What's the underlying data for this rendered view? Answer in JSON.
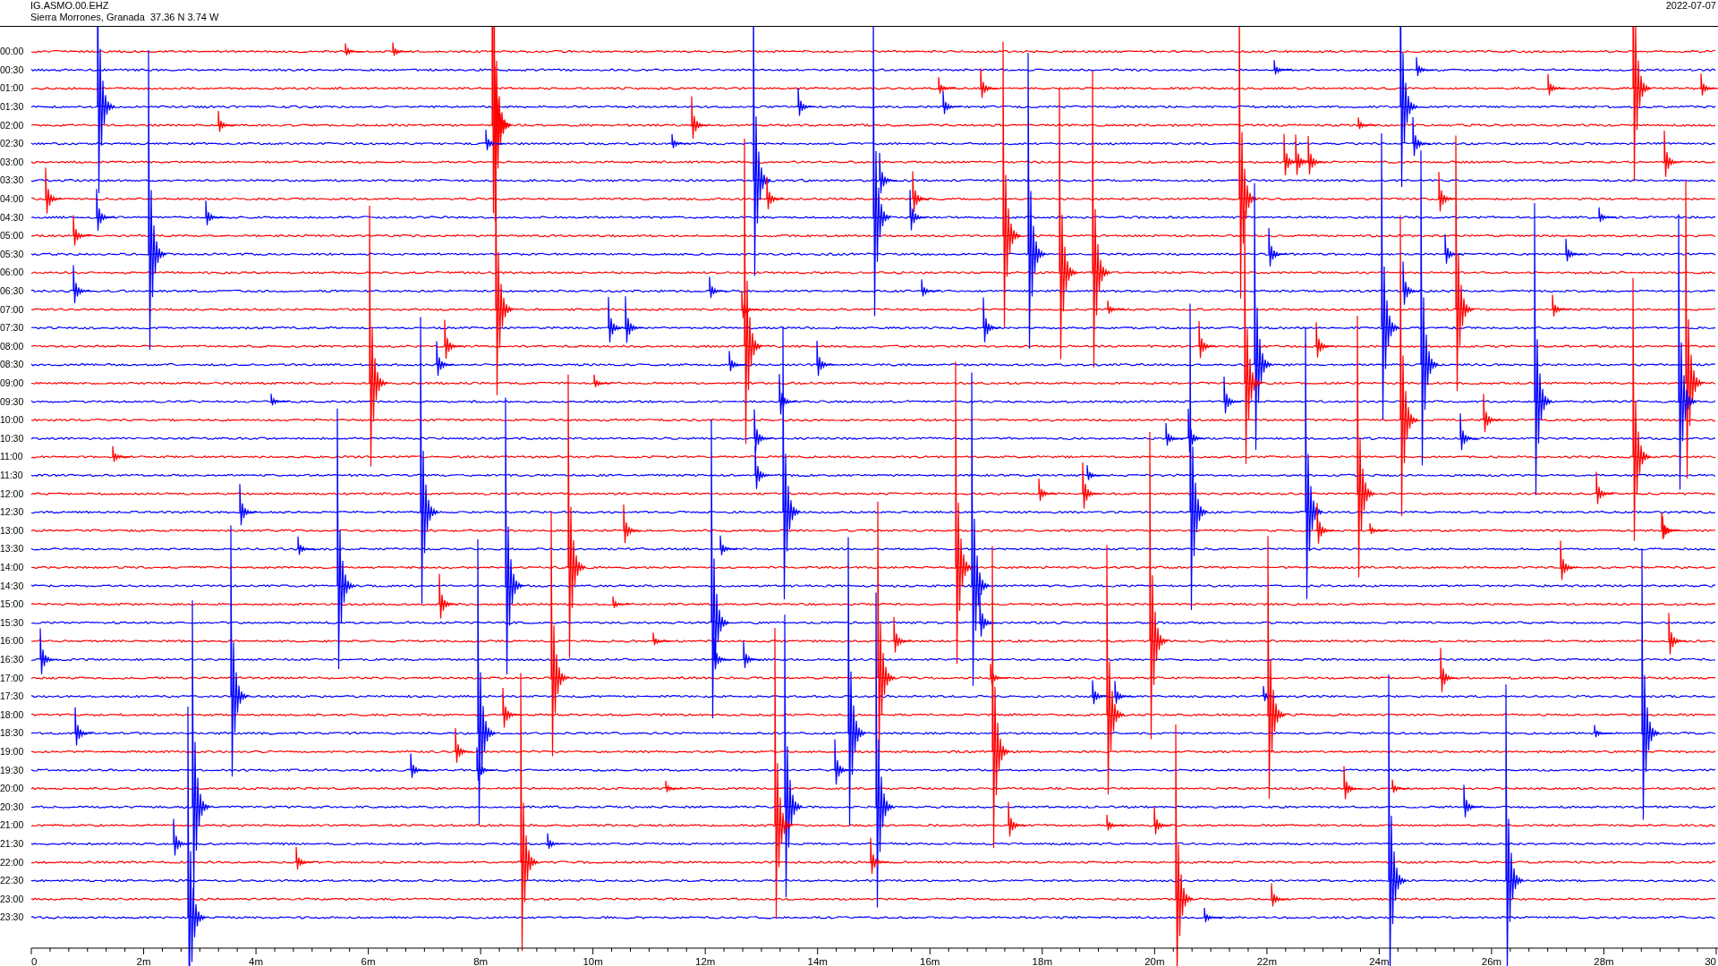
{
  "header": {
    "station": "IG.ASMO.00.EHZ",
    "location": "Sierra Morrones, Granada  37.36 N 3.74 W",
    "date": "2022-07-07"
  },
  "rows": [
    {
      "label": "00:00",
      "color": "#ff0000"
    },
    {
      "label": "00:30",
      "color": "#0000ff"
    },
    {
      "label": "01:00",
      "color": "#ff0000"
    },
    {
      "label": "01:30",
      "color": "#0000ff"
    },
    {
      "label": "02:00",
      "color": "#ff0000"
    },
    {
      "label": "02:30",
      "color": "#0000ff"
    },
    {
      "label": "03:00",
      "color": "#ff0000"
    },
    {
      "label": "03:30",
      "color": "#0000ff"
    },
    {
      "label": "04:00",
      "color": "#ff0000"
    },
    {
      "label": "04:30",
      "color": "#0000ff"
    },
    {
      "label": "05:00",
      "color": "#ff0000"
    },
    {
      "label": "05:30",
      "color": "#0000ff"
    },
    {
      "label": "06:00",
      "color": "#ff0000"
    },
    {
      "label": "06:30",
      "color": "#0000ff"
    },
    {
      "label": "07:00",
      "color": "#ff0000"
    },
    {
      "label": "07:30",
      "color": "#0000ff"
    },
    {
      "label": "08:00",
      "color": "#ff0000"
    },
    {
      "label": "08:30",
      "color": "#0000ff"
    },
    {
      "label": "09:00",
      "color": "#ff0000"
    },
    {
      "label": "09:30",
      "color": "#0000ff"
    },
    {
      "label": "10:00",
      "color": "#ff0000"
    },
    {
      "label": "10:30",
      "color": "#0000ff"
    },
    {
      "label": "11:00",
      "color": "#ff0000"
    },
    {
      "label": "11:30",
      "color": "#0000ff"
    },
    {
      "label": "12:00",
      "color": "#ff0000"
    },
    {
      "label": "12:30",
      "color": "#0000ff"
    },
    {
      "label": "13:00",
      "color": "#ff0000"
    },
    {
      "label": "13:30",
      "color": "#0000ff"
    },
    {
      "label": "14:00",
      "color": "#ff0000"
    },
    {
      "label": "14:30",
      "color": "#0000ff"
    },
    {
      "label": "15:00",
      "color": "#ff0000"
    },
    {
      "label": "15:30",
      "color": "#0000ff"
    },
    {
      "label": "16:00",
      "color": "#ff0000"
    },
    {
      "label": "16:30",
      "color": "#0000ff"
    },
    {
      "label": "17:00",
      "color": "#ff0000"
    },
    {
      "label": "17:30",
      "color": "#0000ff"
    },
    {
      "label": "18:00",
      "color": "#ff0000"
    },
    {
      "label": "18:30",
      "color": "#0000ff"
    },
    {
      "label": "19:00",
      "color": "#ff0000"
    },
    {
      "label": "19:30",
      "color": "#0000ff"
    },
    {
      "label": "20:00",
      "color": "#ff0000"
    },
    {
      "label": "20:30",
      "color": "#0000ff"
    },
    {
      "label": "21:00",
      "color": "#ff0000"
    },
    {
      "label": "21:30",
      "color": "#0000ff"
    },
    {
      "label": "22:00",
      "color": "#ff0000"
    },
    {
      "label": "22:30",
      "color": "#0000ff"
    },
    {
      "label": "23:00",
      "color": "#ff0000"
    },
    {
      "label": "23:30",
      "color": "#0000ff"
    }
  ],
  "x_axis": {
    "tick_labels": [
      "0",
      "2m",
      "4m",
      "6m",
      "8m",
      "10m",
      "12m",
      "14m",
      "16m",
      "18m",
      "20m",
      "22m",
      "24m",
      "26m",
      "28m",
      "30"
    ]
  }
}
